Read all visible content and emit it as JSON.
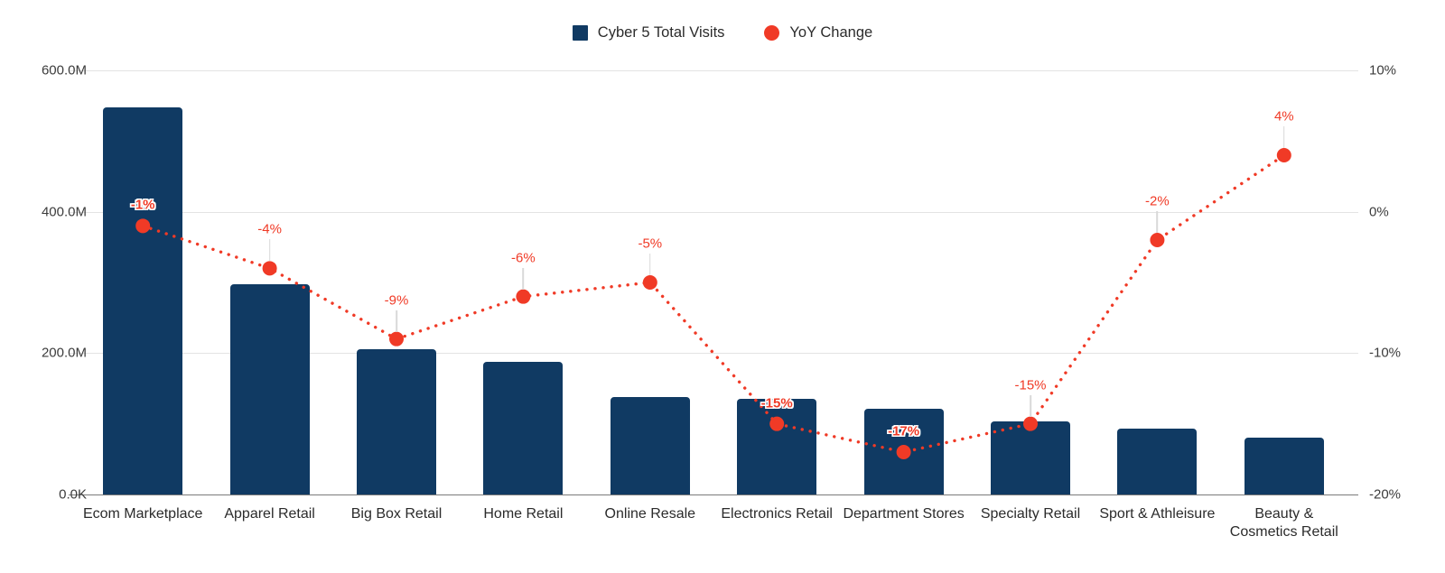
{
  "legend": {
    "items": [
      {
        "label": "Cyber 5 Total Visits",
        "icon": "square-swatch-icon",
        "color": "#103A63"
      },
      {
        "label": "YoY Change",
        "icon": "circle-swatch-icon",
        "color": "#F03A26"
      }
    ]
  },
  "axes": {
    "left_ticks": [
      "600.0M",
      "400.0M",
      "200.0M",
      "0.0K"
    ],
    "right_ticks": [
      "10%",
      "0%",
      "-10%",
      "-20%"
    ]
  },
  "chart_data": {
    "type": "bar",
    "title": "",
    "subtitle": "",
    "xlabel": "",
    "ylabel": "",
    "grid": true,
    "legend_position": "top-center",
    "categories": [
      "Ecom Marketplace",
      "Apparel Retail",
      "Big Box Retail",
      "Home Retail",
      "Online Resale",
      "Electronics Retail",
      "Department Stores",
      "Specialty Retail",
      "Sport & Athleisure",
      "Beauty &\nCosmetics Retail"
    ],
    "series": [
      {
        "name": "Cyber 5 Total Visits",
        "type": "bar",
        "axis": "left",
        "color": "#103A63",
        "values": [
          548000000,
          297000000,
          205000000,
          188000000,
          138000000,
          135000000,
          121000000,
          103000000,
          93000000,
          80000000
        ]
      },
      {
        "name": "YoY Change",
        "type": "line",
        "axis": "right",
        "color": "#F03A26",
        "line_style": "dotted",
        "values": [
          -1,
          -4,
          -9,
          -6,
          -5,
          -15,
          -17,
          -15,
          -2,
          4
        ],
        "labels": [
          "-1%",
          "-4%",
          "-9%",
          "-6%",
          "-5%",
          "-15%",
          "-17%",
          "-15%",
          "-2%",
          "4%"
        ],
        "label_on_bar": [
          true,
          false,
          false,
          false,
          false,
          true,
          true,
          false,
          false,
          false
        ]
      }
    ],
    "ylim": [
      0,
      600000000
    ],
    "y2lim": [
      -20,
      10
    ],
    "ytick_labels": [
      "600.0M",
      "400.0M",
      "200.0M",
      "0.0K"
    ],
    "ytick_values": [
      600000000,
      400000000,
      200000000,
      0
    ],
    "y2tick_labels": [
      "10%",
      "0%",
      "-10%",
      "-20%"
    ],
    "y2tick_values": [
      10,
      0,
      -10,
      -20
    ]
  }
}
